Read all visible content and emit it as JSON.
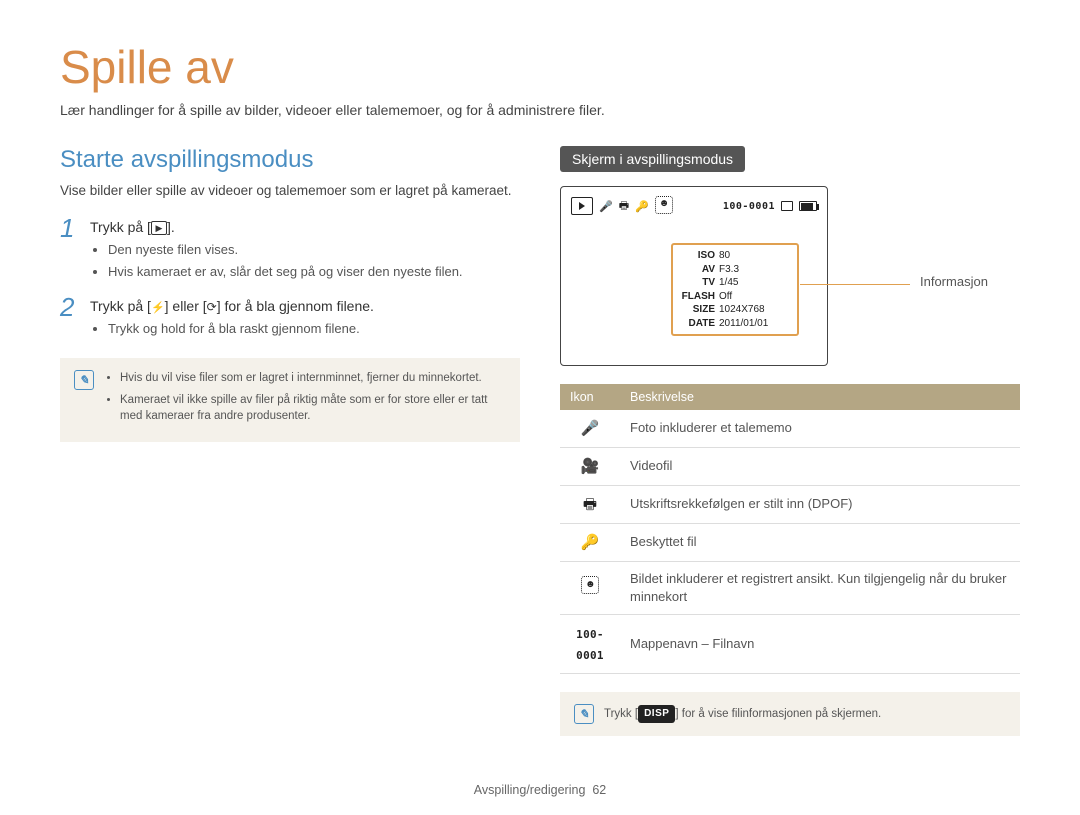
{
  "main_title": "Spille av",
  "subtitle": "Lær handlinger for å spille av bilder, videoer eller talememoer, og for å administrere filer.",
  "left": {
    "heading": "Starte avspillingsmodus",
    "intro": "Vise bilder eller spille av videoer og talememoer som er lagret på kameraet.",
    "step1": {
      "num": "1",
      "text_a": "Trykk på [",
      "text_b": "].",
      "bullets": [
        "Den nyeste filen vises.",
        "Hvis kameraet er av, slår det seg på og viser den nyeste filen."
      ]
    },
    "step2": {
      "num": "2",
      "text_a": "Trykk på [",
      "text_b": "] eller [",
      "text_c": "] for å bla gjennom filene.",
      "bullets": [
        "Trykk og hold for å bla raskt gjennom filene."
      ]
    },
    "note": [
      "Hvis du vil vise filer som er lagret i internminnet, fjerner du minnekortet.",
      "Kameraet vil ikke spille av filer på riktig måte som er for store eller er tatt med kameraer fra andre produsenter."
    ]
  },
  "right": {
    "heading": "Skjerm i avspillingsmodus",
    "callout": "Informasjon",
    "screen_top": {
      "file": "100-0001",
      "card_label": "card-icon"
    },
    "info": {
      "ISO": "80",
      "AV": "F3.3",
      "TV": "1/45",
      "FLASH": "Off",
      "SIZE": "1024X768",
      "DATE": "2011/01/01"
    },
    "table": {
      "head_icon": "Ikon",
      "head_desc": "Beskrivelse",
      "rows": [
        {
          "icon": "🎤",
          "name": "mic-icon",
          "desc": "Foto inkluderer et talememo"
        },
        {
          "icon": "🎥",
          "name": "video-icon",
          "desc": "Videofil"
        },
        {
          "icon": "🖶",
          "name": "print-icon",
          "desc": "Utskriftsrekkefølgen er stilt inn (DPOF)"
        },
        {
          "icon": "🔑",
          "name": "key-icon",
          "desc": "Beskyttet fil"
        },
        {
          "icon": "face",
          "name": "face-detect-icon",
          "desc": "Bildet inkluderer et registrert ansikt. Kun tilgjengelig når du bruker minnekort"
        },
        {
          "icon": "100-0001",
          "name": "folder-filename-icon",
          "desc": "Mappenavn – Filnavn"
        }
      ]
    },
    "note2_a": "Trykk [",
    "note2_disp": "DISP",
    "note2_b": "] for å vise filinformasjonen på skjermen."
  },
  "footer": {
    "section": "Avspilling/redigering",
    "page": "62"
  }
}
